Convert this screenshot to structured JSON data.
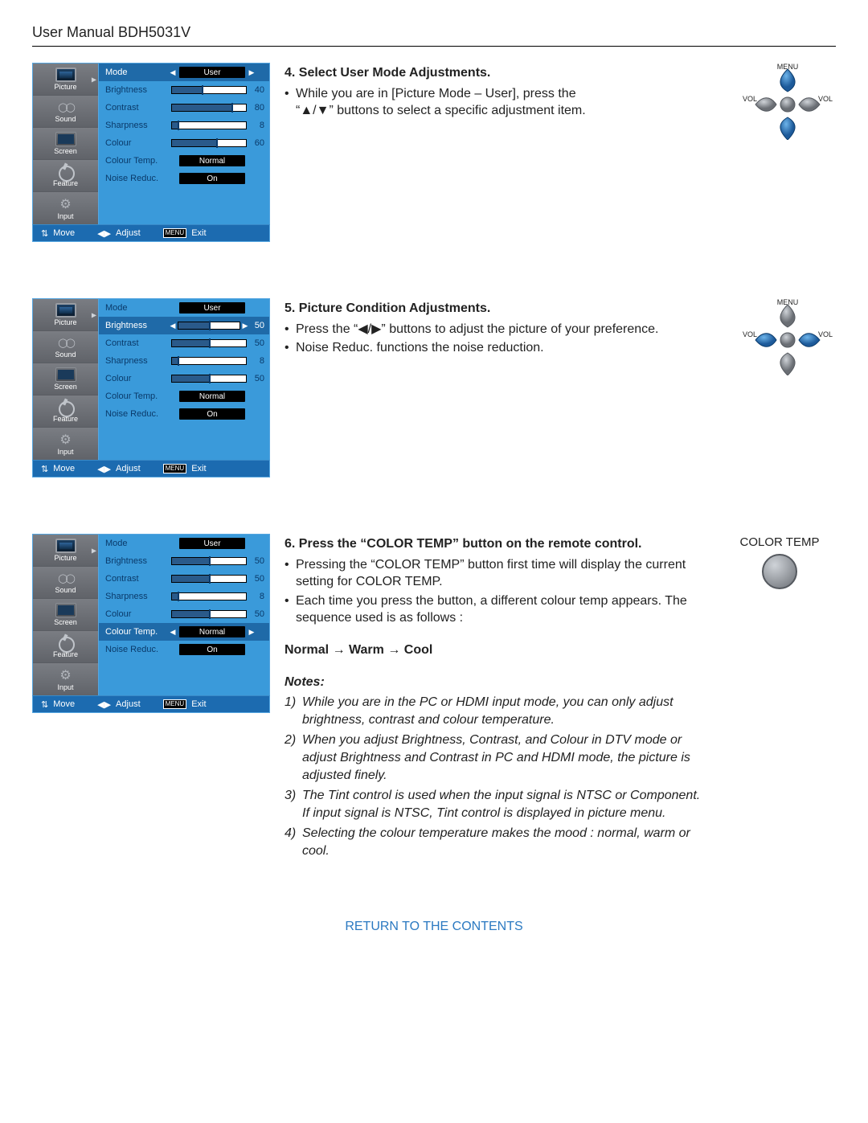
{
  "header": {
    "title": "User Manual BDH5031V"
  },
  "tabs": [
    {
      "label": "Picture"
    },
    {
      "label": "Sound"
    },
    {
      "label": "Screen"
    },
    {
      "label": "Feature"
    },
    {
      "label": "Input"
    }
  ],
  "osd_footer": {
    "move": "Move",
    "adjust": "Adjust",
    "menu": "MENU",
    "exit": "Exit"
  },
  "dpad": {
    "menu": "MENU",
    "vol": "VOL"
  },
  "osd1": {
    "selected": 0,
    "rows": [
      {
        "label": "Mode",
        "type": "pill",
        "value": "User"
      },
      {
        "label": "Brightness",
        "type": "slider",
        "value": 40
      },
      {
        "label": "Contrast",
        "type": "slider",
        "value": 80
      },
      {
        "label": "Sharpness",
        "type": "slider",
        "value": 8
      },
      {
        "label": "Colour",
        "type": "slider",
        "value": 60
      },
      {
        "label": "Colour Temp.",
        "type": "pill",
        "value": "Normal"
      },
      {
        "label": "Noise Reduc.",
        "type": "pill",
        "value": "On"
      }
    ]
  },
  "osd2": {
    "selected": 1,
    "rows": [
      {
        "label": "Mode",
        "type": "pill",
        "value": "User"
      },
      {
        "label": "Brightness",
        "type": "slider",
        "value": 50
      },
      {
        "label": "Contrast",
        "type": "slider",
        "value": 50
      },
      {
        "label": "Sharpness",
        "type": "slider",
        "value": 8
      },
      {
        "label": "Colour",
        "type": "slider",
        "value": 50
      },
      {
        "label": "Colour Temp.",
        "type": "pill",
        "value": "Normal"
      },
      {
        "label": "Noise Reduc.",
        "type": "pill",
        "value": "On"
      }
    ]
  },
  "osd3": {
    "selected": 5,
    "rows": [
      {
        "label": "Mode",
        "type": "pill",
        "value": "User"
      },
      {
        "label": "Brightness",
        "type": "slider",
        "value": 50
      },
      {
        "label": "Contrast",
        "type": "slider",
        "value": 50
      },
      {
        "label": "Sharpness",
        "type": "slider",
        "value": 8
      },
      {
        "label": "Colour",
        "type": "slider",
        "value": 50
      },
      {
        "label": "Colour Temp.",
        "type": "pill",
        "value": "Normal"
      },
      {
        "label": "Noise Reduc.",
        "type": "pill",
        "value": "On"
      }
    ]
  },
  "step4": {
    "title": "4. Select User Mode Adjustments.",
    "b1a": "While you are in [Picture Mode – User], press the",
    "b1b": "“▲/▼” buttons to select a specific adjustment item."
  },
  "step5": {
    "title": "5. Picture Condition Adjustments.",
    "b1": "Press the “◀/▶” buttons to adjust the picture of your preference.",
    "b2": "Noise Reduc. functions the noise reduction."
  },
  "step6": {
    "title": "6. Press the “COLOR TEMP” button on the remote control.",
    "b1": "Pressing the “COLOR TEMP” button first time will display the current setting for COLOR TEMP.",
    "b2": "Each time you press the button, a different colour temp appears. The sequence used is as follows :",
    "seq": "Normal → Warm → Cool",
    "notes_hd": "Notes:",
    "n1": "While you are in the PC or HDMI input mode, you can only adjust brightness, contrast and colour temperature.",
    "n2": "When you adjust Brightness, Contrast, and Colour in DTV mode or adjust Brightness and Contrast in PC and HDMI mode, the picture is adjusted finely.",
    "n3": "The Tint control is used when the input signal is NTSC or Component. If input signal is NTSC, Tint control is displayed in picture menu.",
    "n4": "Selecting the colour temperature makes the mood : normal, warm or cool."
  },
  "colortemp_label": "COLOR TEMP",
  "return_link": "RETURN TO THE CONTENTS"
}
